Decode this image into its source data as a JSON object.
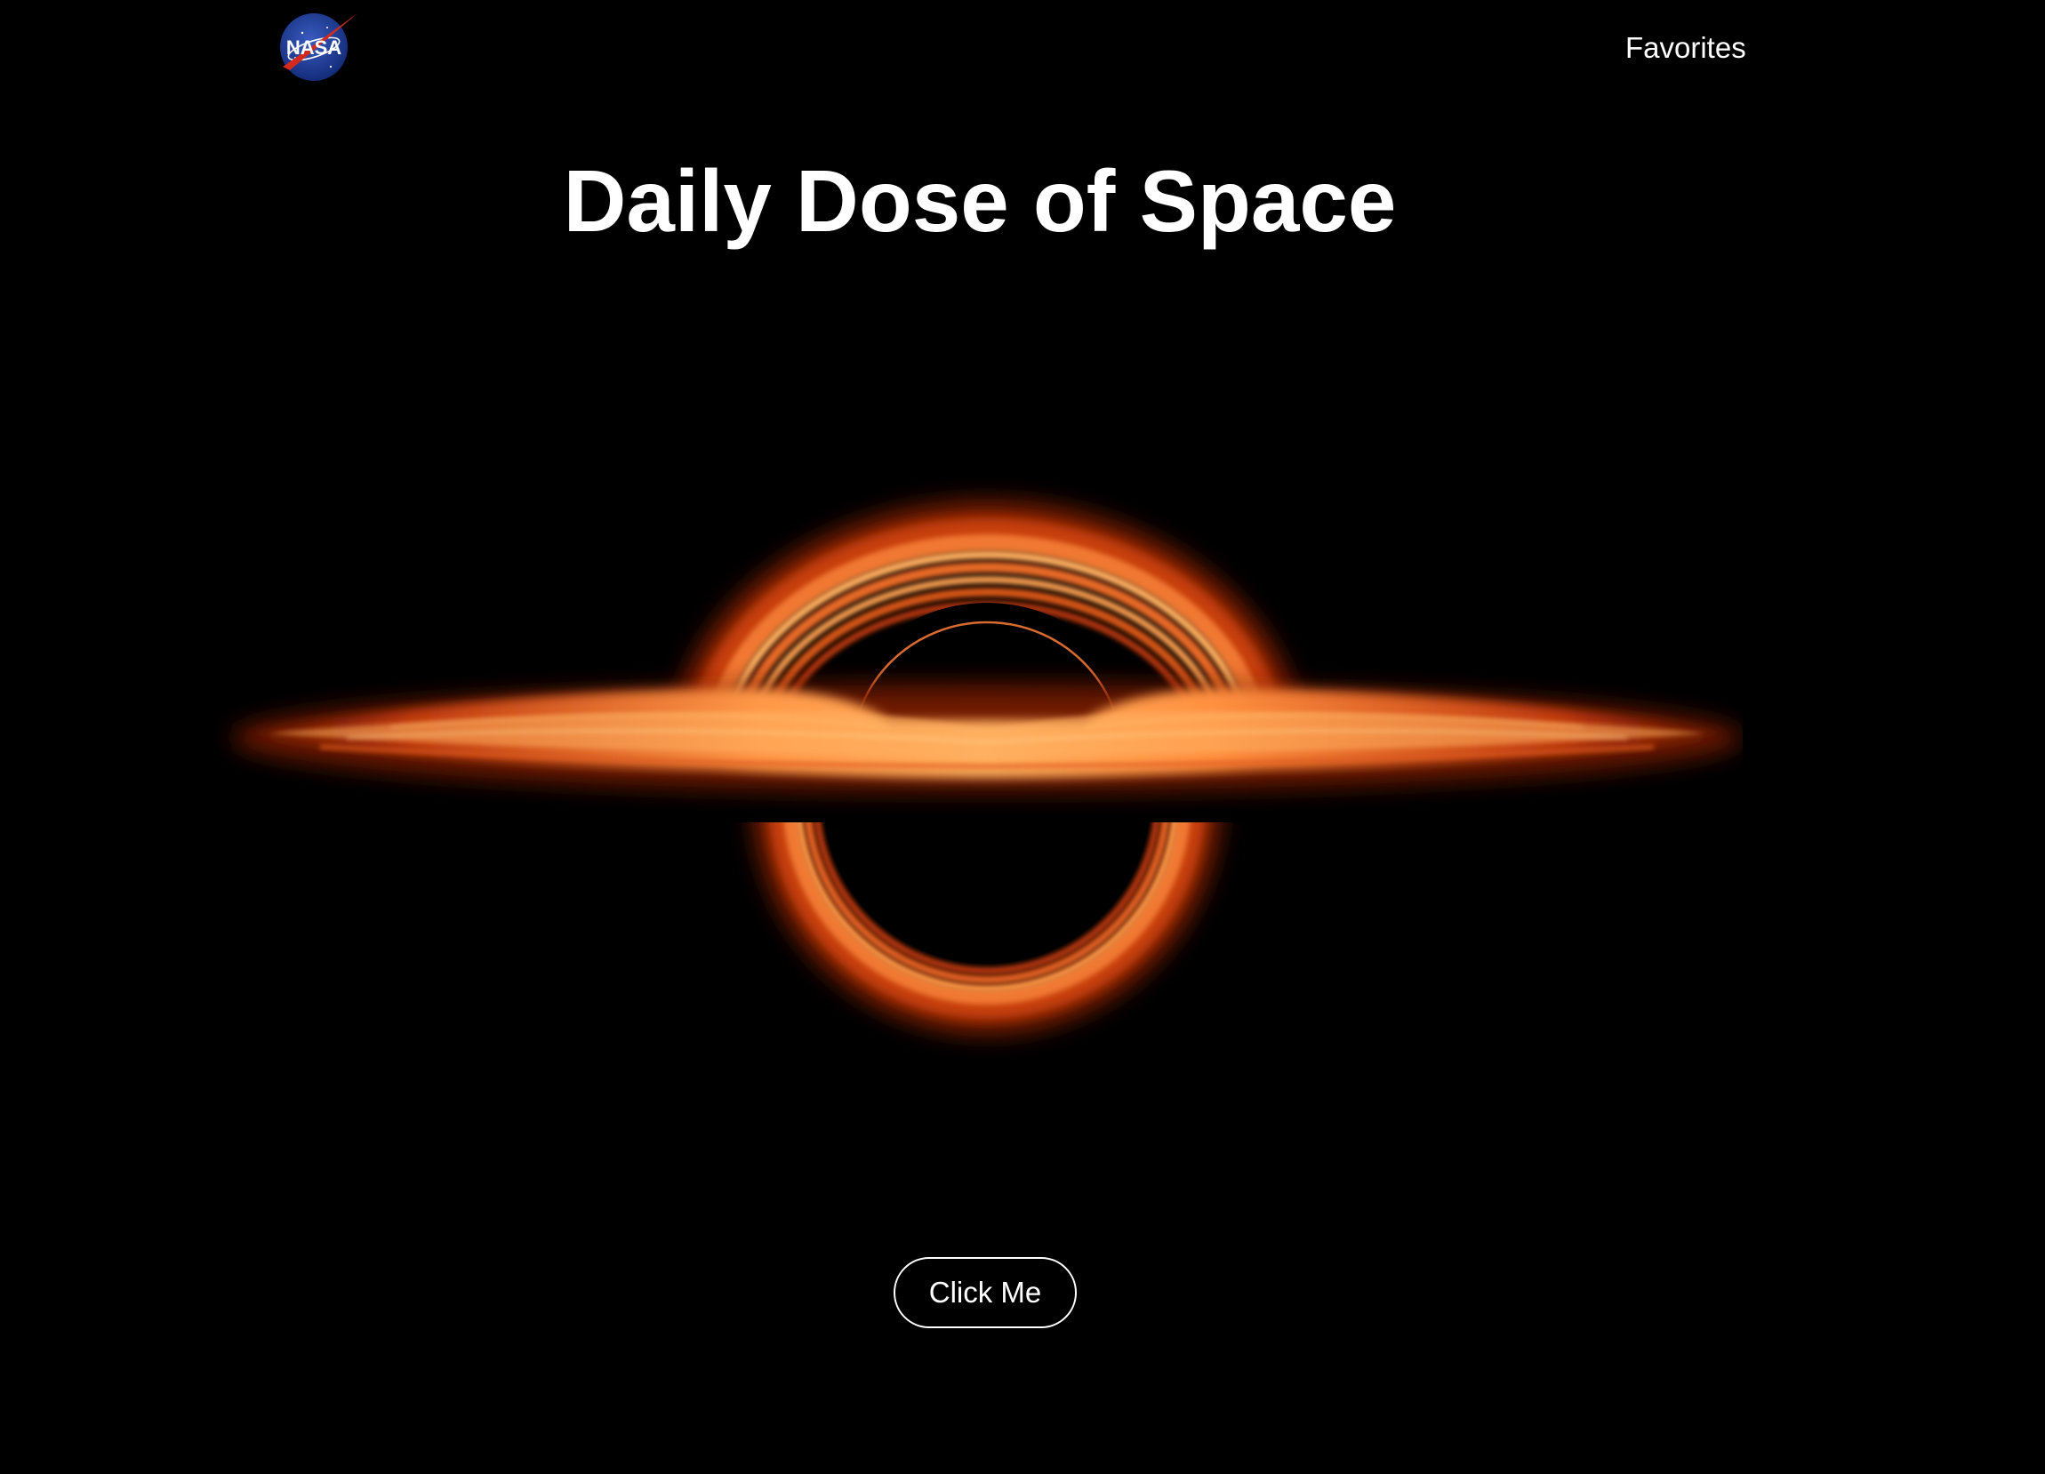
{
  "nav": {
    "logo_icon": "nasa-meatball-logo-icon",
    "logo_text": "NASA",
    "favorites_label": "Favorites"
  },
  "hero": {
    "title": "Daily Dose of Space"
  },
  "apod_image": {
    "subject": "black-hole-accretion-disk",
    "colors": {
      "background": "#000000",
      "disk_bright": "#ffb060",
      "disk_mid": "#f07830",
      "disk_dark": "#a02808"
    }
  },
  "cta": {
    "label": "Click Me"
  },
  "theme": {
    "background": "#000000",
    "text": "#ffffff",
    "logo_blue": "#1f3f9a",
    "logo_red": "#d32a1f"
  }
}
